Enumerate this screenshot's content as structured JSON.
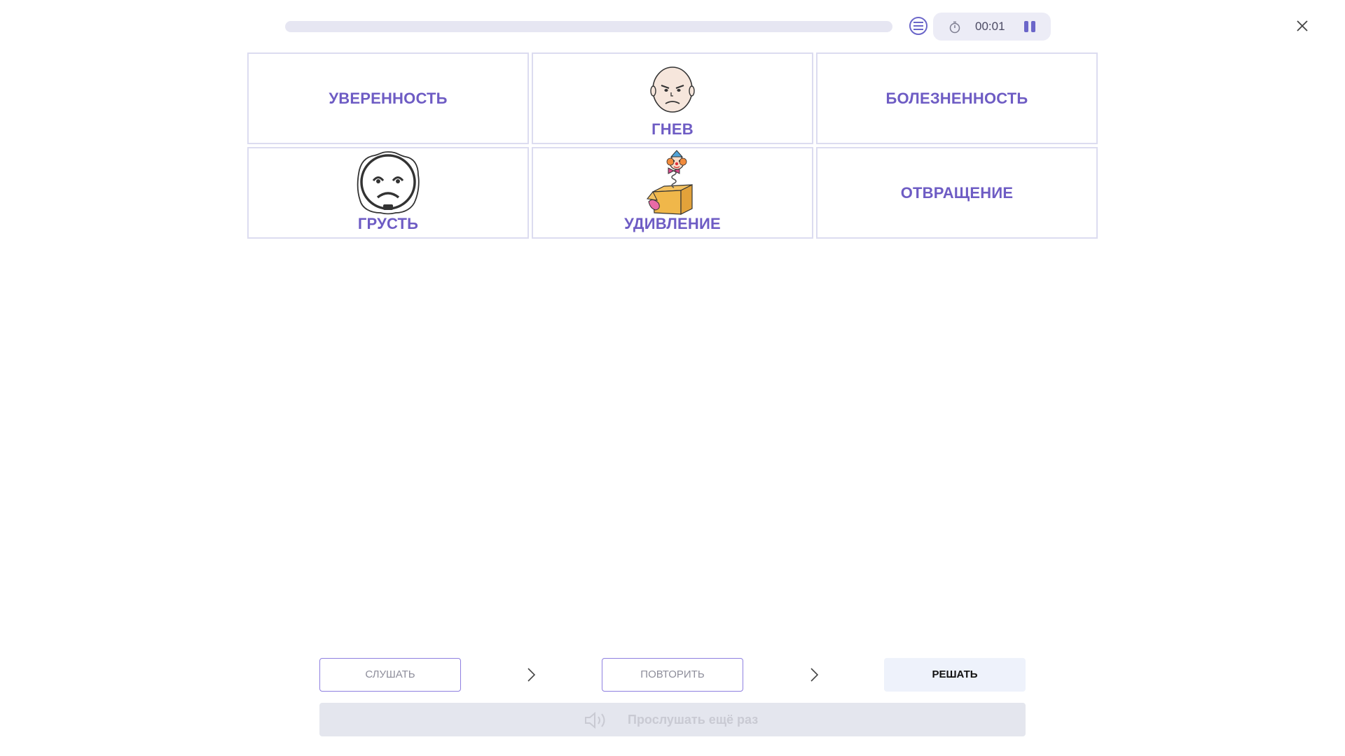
{
  "progress": {
    "fraction": 0.0
  },
  "timer": {
    "time": "00:01"
  },
  "cards": [
    {
      "label": "УВЕРЕННОСТЬ",
      "icon": "none"
    },
    {
      "label": "ГНЕВ",
      "icon": "angry-face-icon"
    },
    {
      "label": "БОЛЕЗНЕННОСТЬ",
      "icon": "none"
    },
    {
      "label": "ГРУСТЬ",
      "icon": "sad-face-icon"
    },
    {
      "label": "УДИВЛЕНИЕ",
      "icon": "jack-in-the-box-icon"
    },
    {
      "label": "ОТВРАЩЕНИЕ",
      "icon": "none"
    }
  ],
  "controls": {
    "listen_label": "СЛУШАТЬ",
    "repeat_label": "ПОВТОРИТЬ",
    "solve_label": "РЕШАТЬ",
    "listen_again_label": "Прослушать ещё раз"
  },
  "colors": {
    "accent": "#6e5cc4",
    "card_border": "#dcdcf0",
    "timer_bg": "#ececf6",
    "solve_bg": "#eef2fb",
    "disabled_bg": "#e4e6ee"
  }
}
